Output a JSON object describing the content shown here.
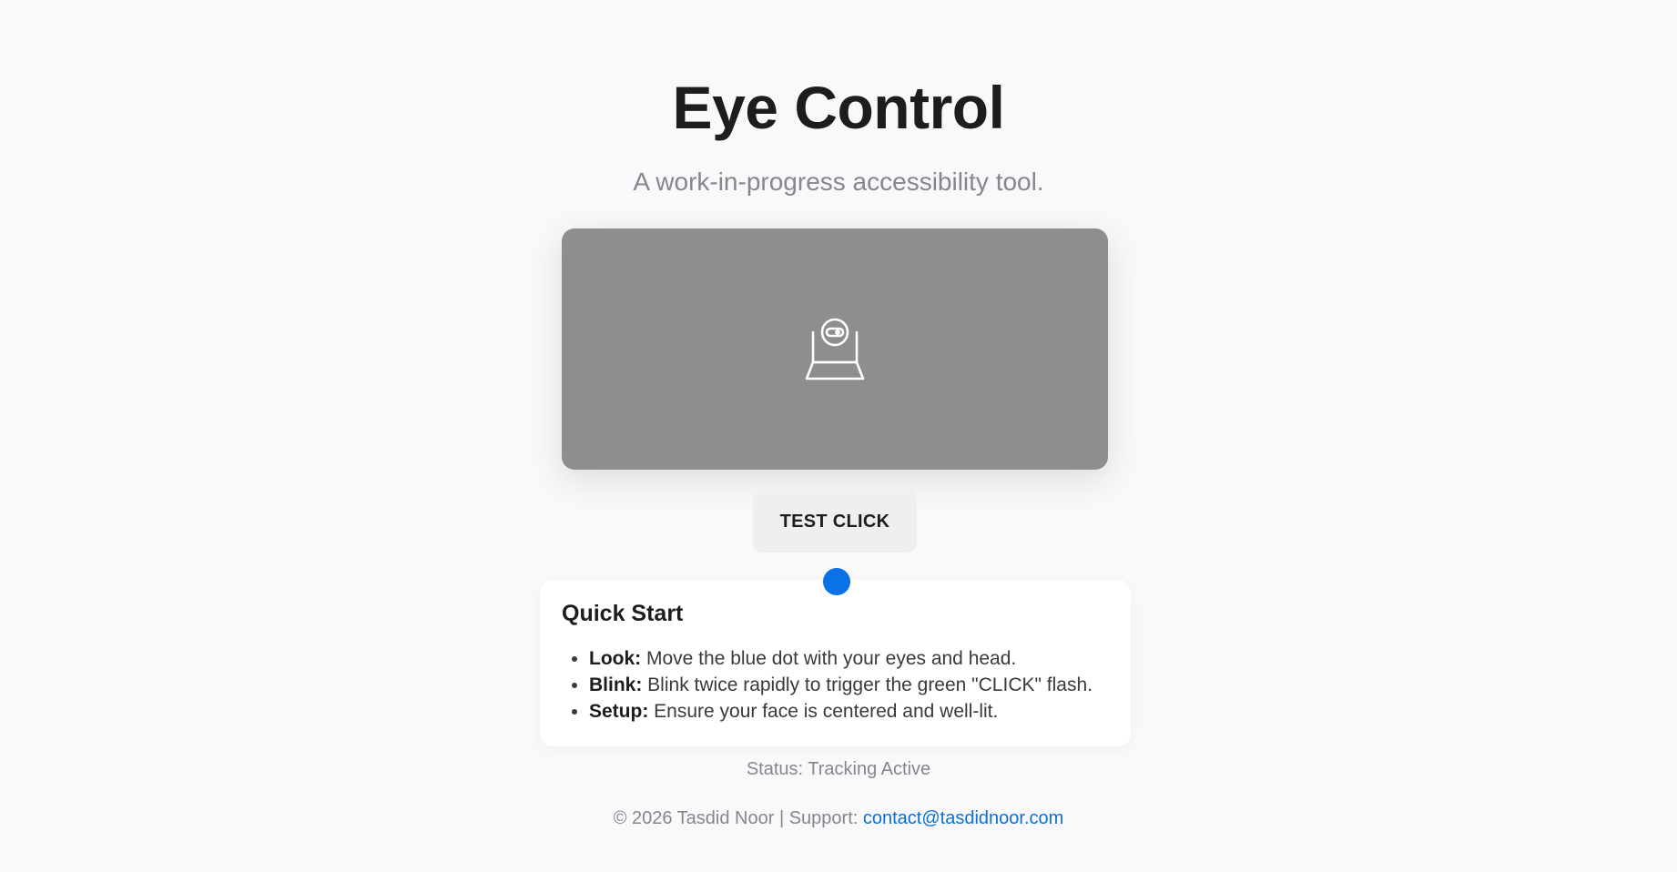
{
  "header": {
    "title": "Eye Control",
    "subtitle": "A work-in-progress accessibility tool."
  },
  "camera": {
    "icon": "webcam-icon",
    "background_color": "#8e8e90"
  },
  "test_button": {
    "label": "TEST CLICK"
  },
  "gaze_dot": {
    "color": "#0a72e6"
  },
  "quick_start": {
    "title": "Quick Start",
    "items": [
      {
        "term": "Look:",
        "text": " Move the blue dot with your eyes and head."
      },
      {
        "term": "Blink:",
        "text": " Blink twice rapidly to trigger the green \"CLICK\" flash."
      },
      {
        "term": "Setup:",
        "text": " Ensure your face is centered and well-lit."
      }
    ]
  },
  "status": {
    "text": "Status: Tracking Active"
  },
  "footer": {
    "copyright": "© 2026 Tasdid Noor | Support: ",
    "email": "contact@tasdidnoor.com"
  },
  "colors": {
    "page_background": "#f9f9fb",
    "accent": "#0a72e6",
    "link": "#0a6fd9"
  }
}
